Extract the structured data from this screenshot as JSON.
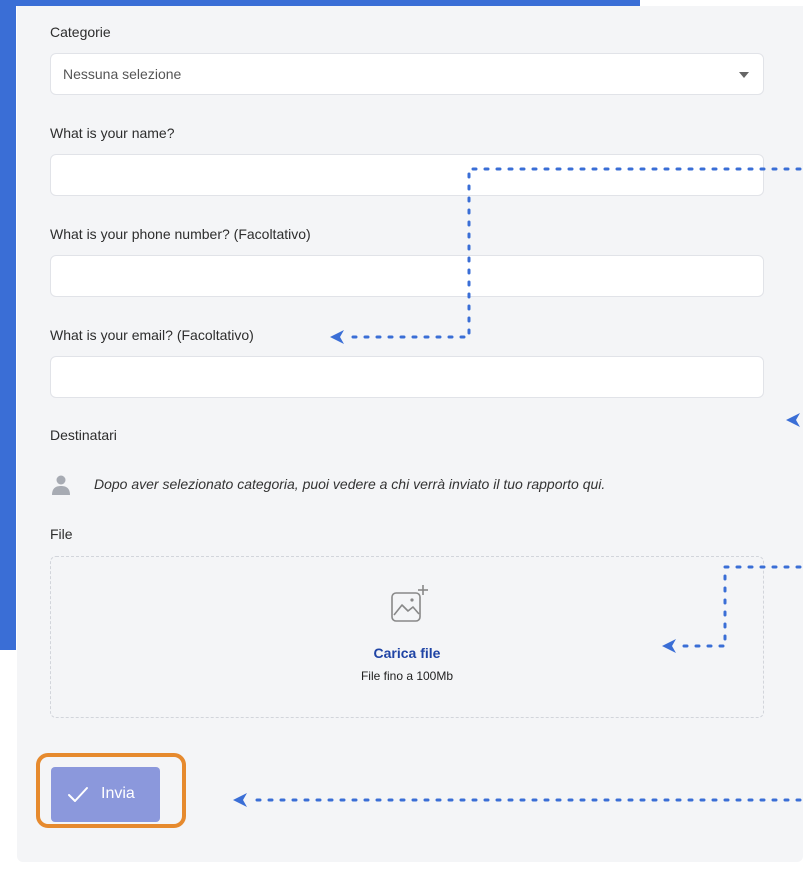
{
  "form": {
    "categories_label": "Categorie",
    "categories_value": "Nessuna selezione",
    "name_label": "What is your name?",
    "phone_label": "What is your phone number? (Facoltativo)",
    "email_label": "What is your email? (Facoltativo)",
    "recipients_label": "Destinatari",
    "recipients_note": "Dopo aver selezionato categoria, puoi vedere a chi verrà inviato il tuo rapporto qui.",
    "file_label": "File",
    "upload_link": "Carica file",
    "upload_limit": "File fino a 100Mb",
    "submit_label": "Invia"
  },
  "colors": {
    "brand_blue": "#3a6ed6",
    "submit_bg": "#8b98dc",
    "highlight_orange": "#e68a2e",
    "link_blue": "#1f44a5"
  },
  "icons": [
    "chevron-down-icon",
    "person-icon",
    "image-upload-icon",
    "check-icon"
  ]
}
